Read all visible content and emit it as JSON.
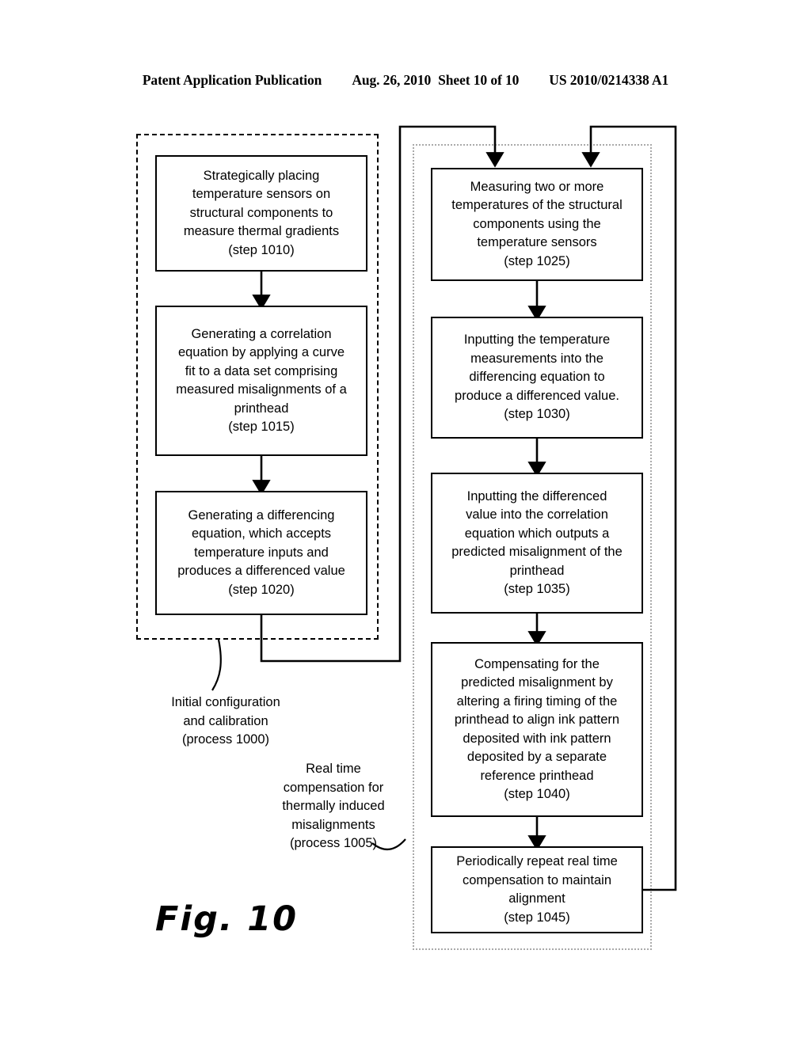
{
  "header": {
    "publication": "Patent Application Publication",
    "date": "Aug. 26, 2010",
    "sheet": "Sheet 10 of 10",
    "number": "US 2010/0214338 A1"
  },
  "figure": {
    "caption": "Fig. 10"
  },
  "groups": {
    "initial": {
      "label": "Initial configuration\nand calibration\n(process 1000)",
      "style": "dashed"
    },
    "realtime": {
      "label": "Real time\ncompensation for\nthermally induced\nmisalignments\n(process 1005)",
      "style": "dotted"
    }
  },
  "steps": {
    "s1010": "Strategically placing\ntemperature sensors on\nstructural components to\nmeasure thermal gradients\n(step 1010)",
    "s1015": "Generating a correlation\nequation by applying a curve\nfit to a data set comprising\nmeasured misalignments of a\nprinthead\n(step 1015)",
    "s1020": "Generating a differencing\nequation, which accepts\ntemperature inputs and\nproduces a differenced value\n(step 1020)",
    "s1025": "Measuring two or more\ntemperatures of the structural\ncomponents using the\ntemperature sensors\n(step 1025)",
    "s1030": "Inputting the temperature\nmeasurements into the\ndifferencing equation to\nproduce a differenced value.\n(step 1030)",
    "s1035": "Inputting the differenced\nvalue into the correlation\nequation which outputs a\npredicted misalignment of the\nprinthead\n(step 1035)",
    "s1040": "Compensating for the\npredicted misalignment by\naltering a firing timing of the\nprinthead to align ink pattern\ndeposited with ink pattern\ndeposited by a separate\nreference printhead\n(step 1040)",
    "s1045": "Periodically repeat real time\ncompensation to maintain\nalignment\n(step 1045)"
  },
  "colors": {
    "ink": "#000000",
    "page": "#ffffff",
    "dotted_group": "#aaaaaa"
  }
}
